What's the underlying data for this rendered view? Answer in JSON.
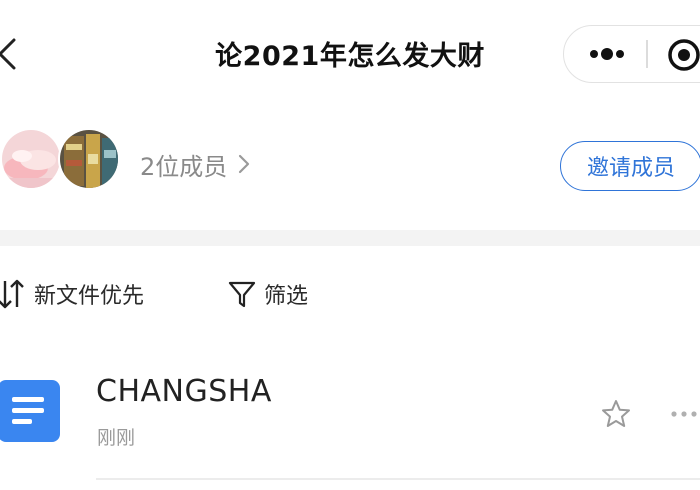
{
  "nav": {
    "title": "论2021年怎么发大财",
    "icons": {
      "back": "back-arrow-icon",
      "more": "more-dots-icon",
      "close": "target-close-icon"
    }
  },
  "members": {
    "count_label": "2位成员",
    "invite_label": "邀请成员",
    "avatars": [
      "avatar-pink-shoes",
      "avatar-store-shelves"
    ]
  },
  "toolbar": {
    "sort_label": "新文件优先",
    "filter_label": "筛选"
  },
  "files": [
    {
      "name": "CHANGSHA",
      "time": "刚刚",
      "icon": "document-icon"
    }
  ],
  "colors": {
    "accent": "#2f74d8",
    "doc_icon": "#3a86f0",
    "muted_text": "#8a8a8a"
  }
}
